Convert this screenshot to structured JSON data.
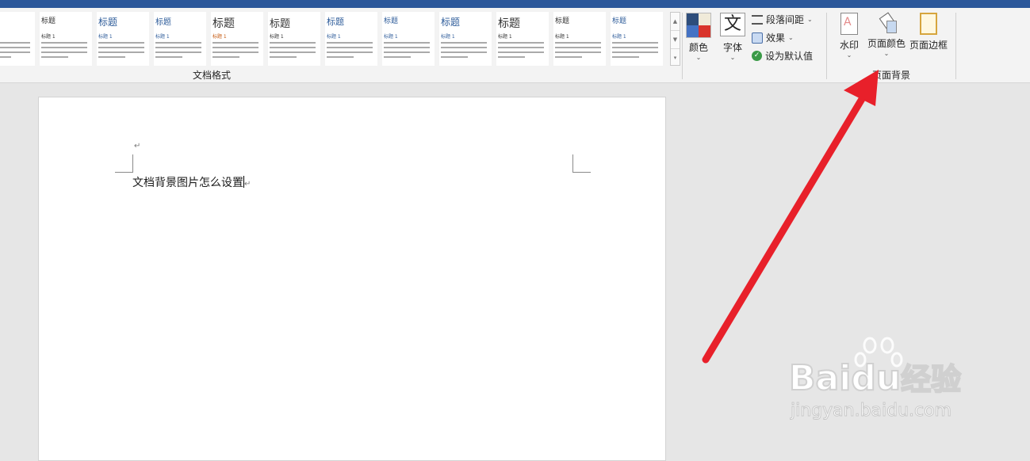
{
  "ribbon": {
    "style_thumbnails": [
      {
        "heading": "题",
        "sub": "",
        "size": 10
      },
      {
        "heading": "标题",
        "sub": "标题 1",
        "size": 9
      },
      {
        "heading": "标题",
        "sub": "标题 1",
        "size": 12
      },
      {
        "heading": "标题",
        "sub": "标题 1",
        "size": 10
      },
      {
        "heading": "标题",
        "sub": "标题 1",
        "size": 14
      },
      {
        "heading": "标题",
        "sub": "标题 1",
        "size": 13
      },
      {
        "heading": "标题",
        "sub": "标题 1",
        "size": 11
      },
      {
        "heading": "标题",
        "sub": "标题 1",
        "size": 9
      },
      {
        "heading": "标题",
        "sub": "标题 1",
        "size": 12
      },
      {
        "heading": "标题",
        "sub": "标题 1",
        "size": 14
      },
      {
        "heading": "标题",
        "sub": "标题 1",
        "size": 9
      },
      {
        "heading": "标题",
        "sub": "标题 1",
        "size": 9
      }
    ],
    "group_document_format": "文档格式",
    "colors_label": "颜色",
    "fonts_label": "字体",
    "fonts_glyph": "文",
    "paragraph_spacing_label": "段落间距",
    "effects_label": "效果",
    "set_default_label": "设为默认值",
    "watermark_label": "水印",
    "page_color_label": "页面颜色",
    "page_borders_label": "页面边框",
    "group_page_background": "页面背景"
  },
  "document": {
    "body_text": "文档背景图片怎么设置"
  },
  "watermark": {
    "brand": "Bai",
    "brand2": "du",
    "jingyan": "经验",
    "url": "jingyan.baidu.com"
  },
  "colors": {
    "titlebar": "#2b579a",
    "arrow": "#e8202a"
  }
}
